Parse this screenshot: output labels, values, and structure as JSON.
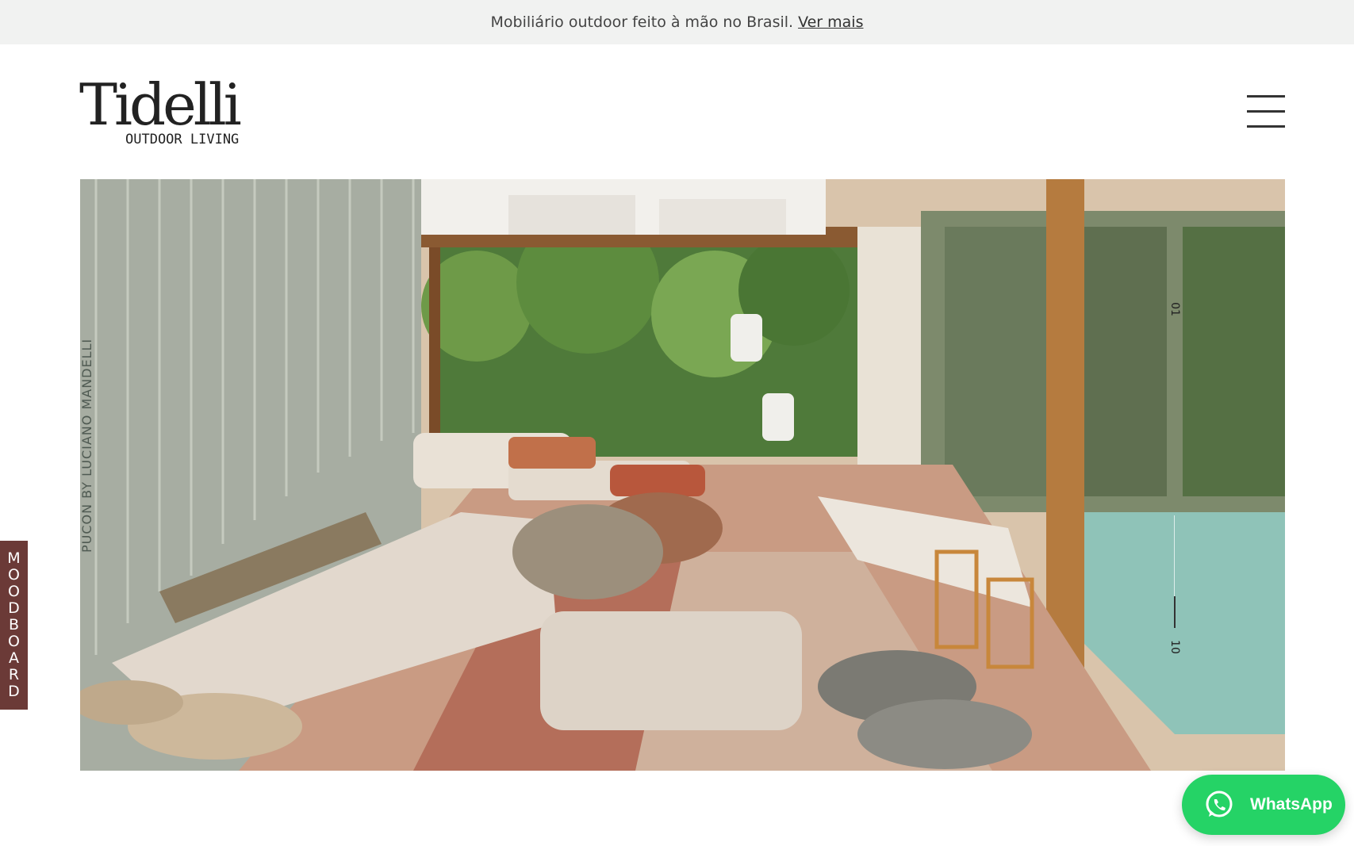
{
  "announcement": {
    "text": "Mobiliário outdoor feito à mão no Brasil.",
    "link_label": "Ver mais"
  },
  "header": {
    "logo_word": "Tidelli",
    "logo_tagline": "OUTDOOR LIVING",
    "menu_icon": "hamburger-menu-icon"
  },
  "hero": {
    "caption": "PUCON BY LUCIANO MANDELLI",
    "counter_current": "01",
    "counter_total": "10"
  },
  "moodboard": {
    "label": "MOODBOARD"
  },
  "whatsapp": {
    "label": "WhatsApp",
    "icon": "whatsapp-icon",
    "color": "#25d366"
  },
  "colors": {
    "moodboard_bg": "#6b3a37",
    "announcement_bg": "#f1f2f1"
  }
}
